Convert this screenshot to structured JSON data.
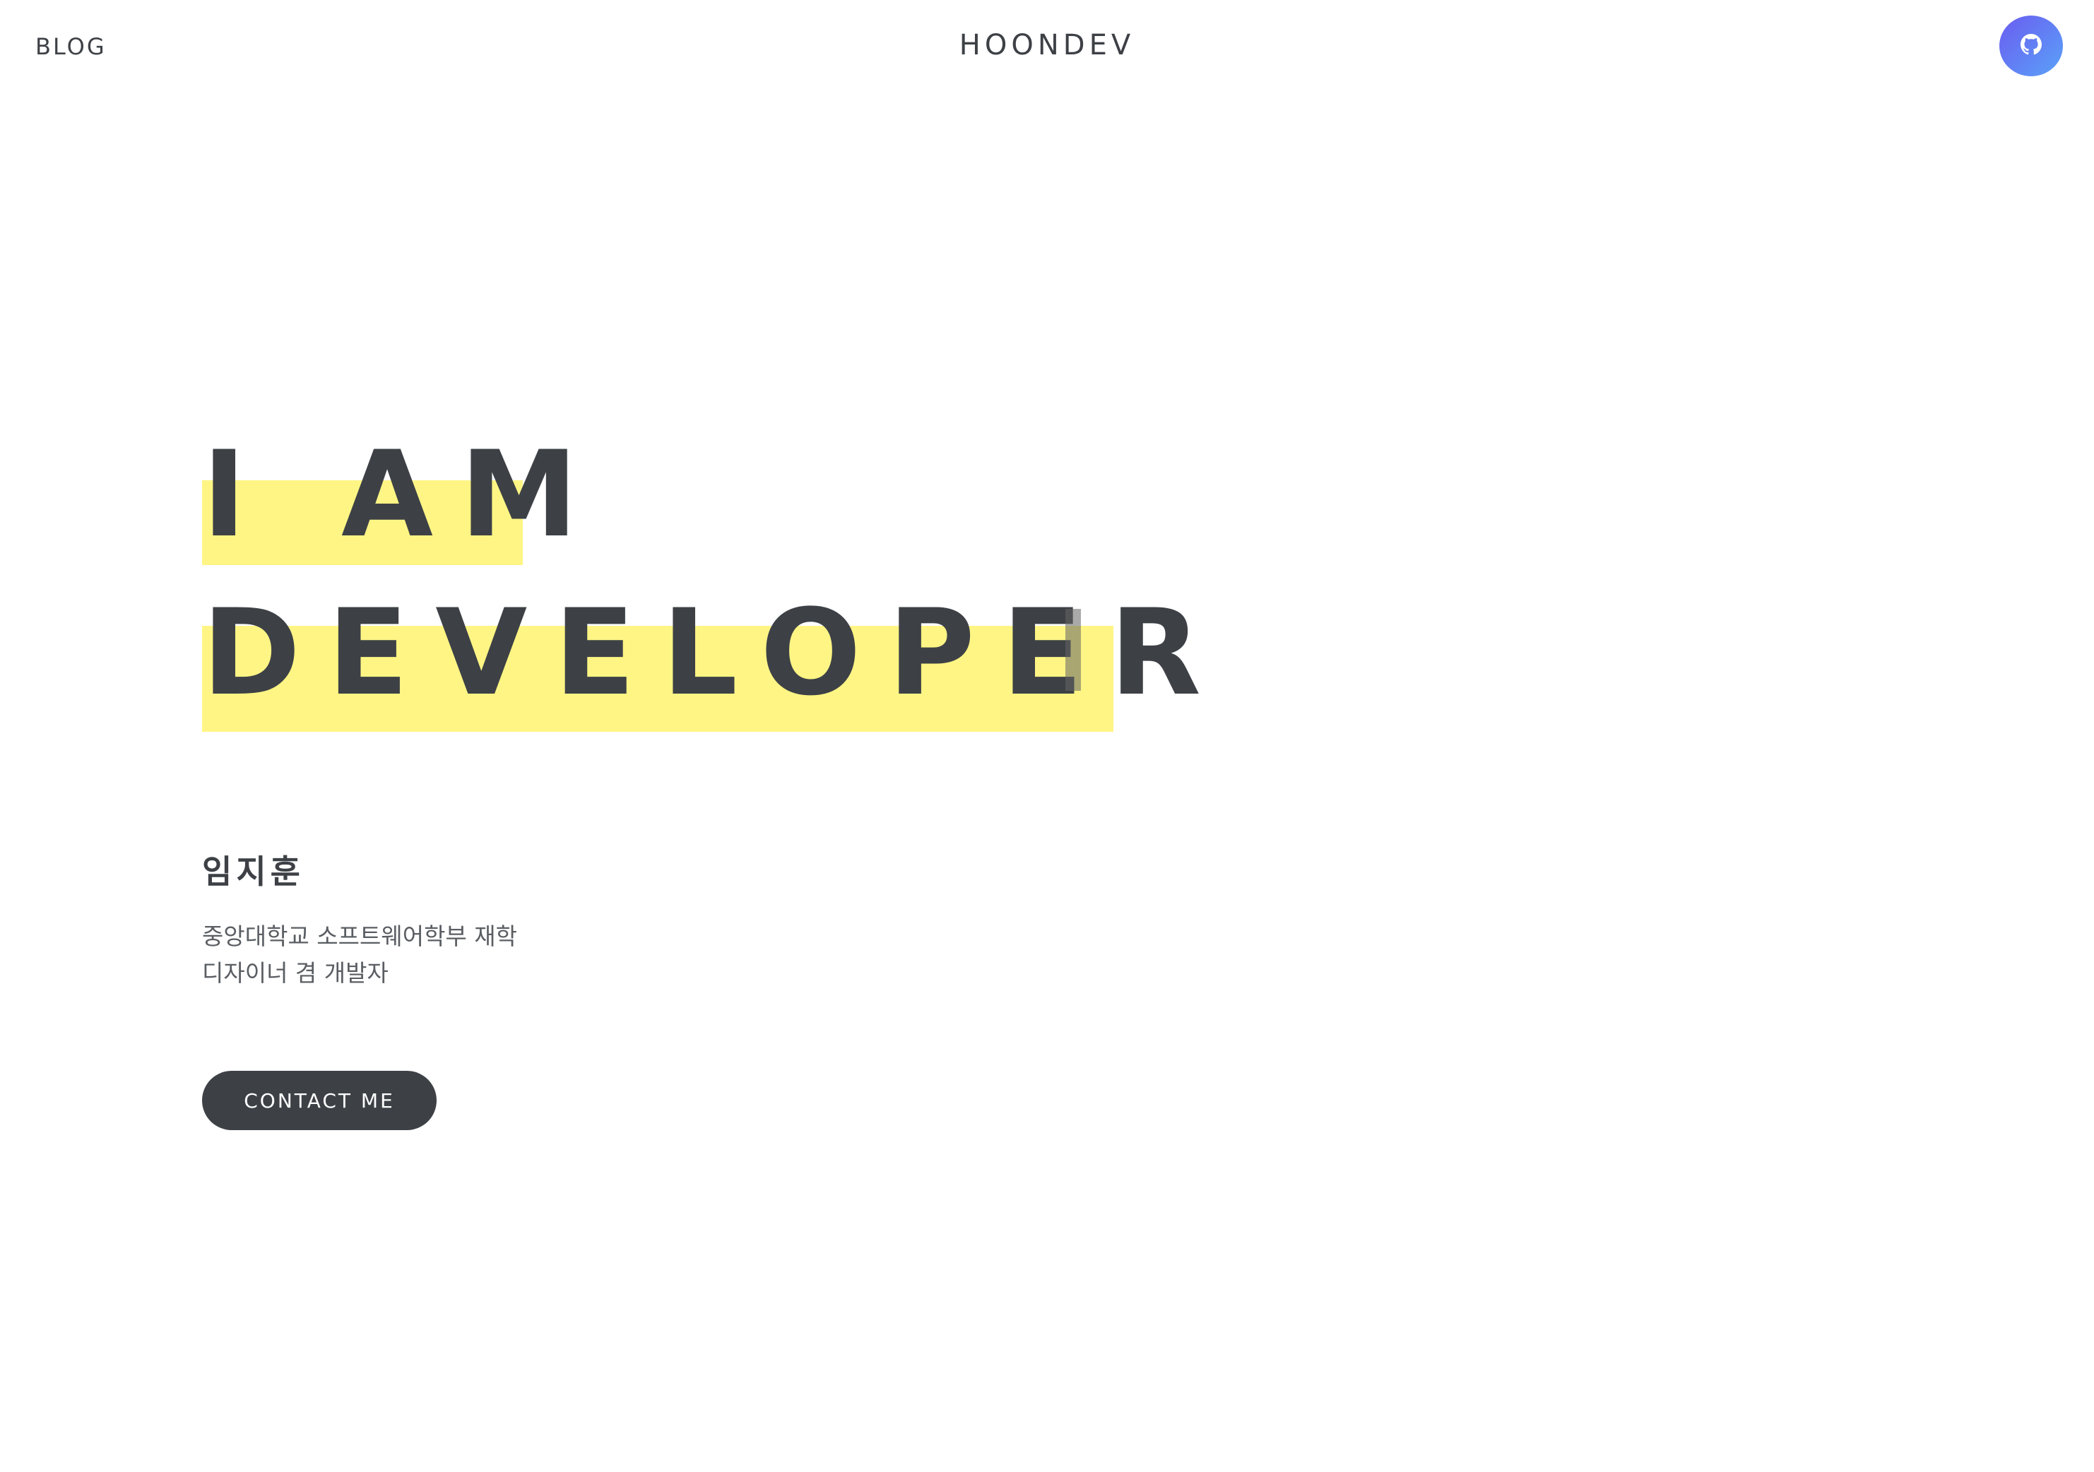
{
  "header": {
    "blog_label": "BLOG",
    "site_title": "HOONDEV",
    "github_icon": "github-icon"
  },
  "hero": {
    "line1": "I AM",
    "line2": "DEVELOPER",
    "highlight_color": "#fff584"
  },
  "profile": {
    "name": "임지훈",
    "description_line1": "중앙대학교 소프트웨어학부 재학",
    "description_line2": "디자이너 겸 개발자"
  },
  "cta": {
    "contact_label": "CONTACT ME"
  },
  "colors": {
    "text": "#3d4146",
    "button_bg": "#3d4146",
    "github_gradient_start": "#6a5cf0",
    "github_gradient_end": "#5aa2f8"
  }
}
